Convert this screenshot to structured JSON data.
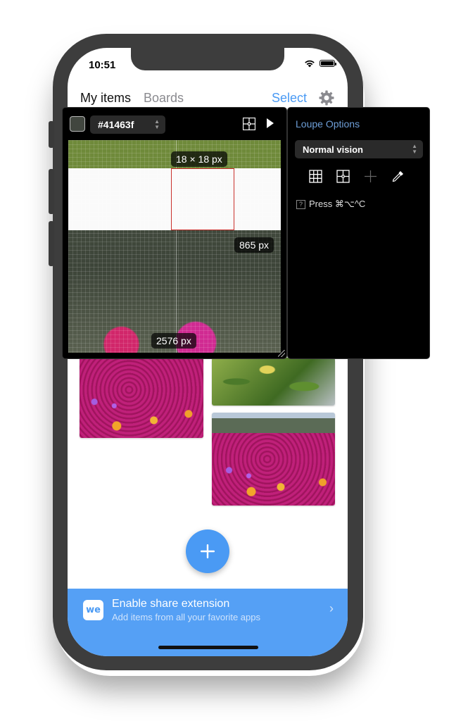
{
  "status_bar": {
    "time": "10:51"
  },
  "nav": {
    "tabs": [
      {
        "label": "My items",
        "active": true
      },
      {
        "label": "Boards",
        "active": false
      }
    ],
    "select_label": "Select",
    "settings_icon": "gear-icon"
  },
  "photos": [
    {
      "subject": "pink flowers"
    },
    {
      "subject": "green leaves"
    },
    {
      "subject": "pink flowers with trees"
    }
  ],
  "fab": {
    "icon": "plus-icon",
    "label": "+"
  },
  "banner": {
    "logo_text": "we",
    "title": "Enable share extension",
    "subtitle": "Add items from all your favorite apps",
    "chevron": "›"
  },
  "loupe": {
    "color_hex": "#41463f",
    "selection_size": "18 × 18 px",
    "width_readout": "865 px",
    "height_readout": "2576 px"
  },
  "loupe_options": {
    "title": "Loupe Options",
    "vision_mode": "Normal vision",
    "shortcut_text": "Press ⌘⌥^C",
    "help_glyph": "?"
  },
  "colors": {
    "accent": "#4a9af4",
    "banner": "#55a0f5",
    "picked": "#41463f"
  }
}
